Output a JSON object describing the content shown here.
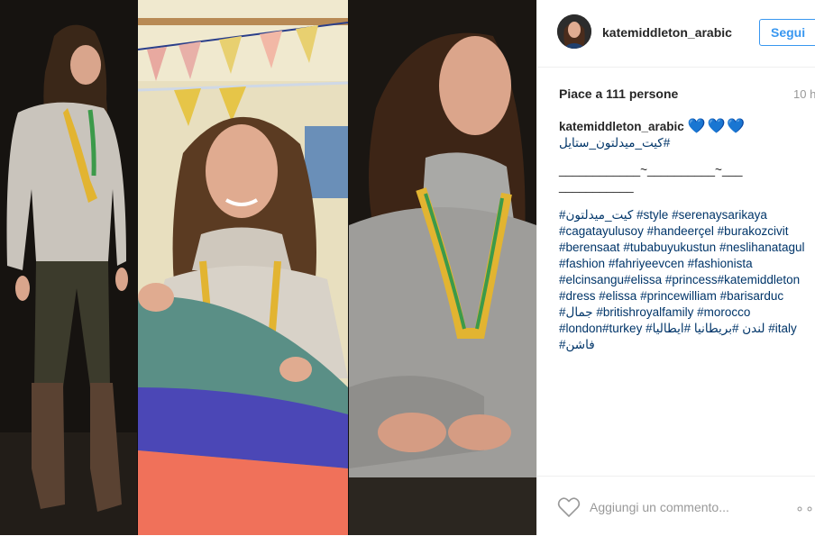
{
  "post": {
    "username": "katemiddleton_arabic",
    "follow_label": "Segui",
    "likes_text": "Piace a 111 persone",
    "time_ago": "10 h",
    "caption": {
      "username": "katemiddleton_arabic",
      "hearts": "💙💙💙",
      "first_tag": "#كيت_ميدلتون_ستايل",
      "divider": "____________~__________~___\n___________"
    },
    "hashtags": [
      "#كيت_ميدلتون",
      "#style",
      "#serenaysarikaya",
      "#cagatayulusoy",
      "#handeerçel",
      "#burakozcivit",
      "#berensaat",
      "#tubabuyukustun",
      "#neslihanatagul",
      "#fashion",
      "#fahriyeevcen",
      "#fashionista",
      "#elcinsangu#elissa",
      "#princess#katemiddleton",
      "#dress",
      "#elissa",
      "#princewilliam",
      "#barisarduc",
      "#جمال",
      "#britishroyalfamily",
      "#morocco",
      "#london#turkey",
      "#لندن",
      "#بريطانيا",
      "#ايطاليا",
      "#italy",
      "#فاشن"
    ]
  },
  "comment": {
    "placeholder": "Aggiungi un commento..."
  },
  "icons": {
    "like": "heart-outline-icon",
    "more": "more-options-icon"
  },
  "colors": {
    "accent": "#3897f0",
    "hashtag": "#003569",
    "heart_emoji": "#29a8f5",
    "muted": "#999999"
  }
}
